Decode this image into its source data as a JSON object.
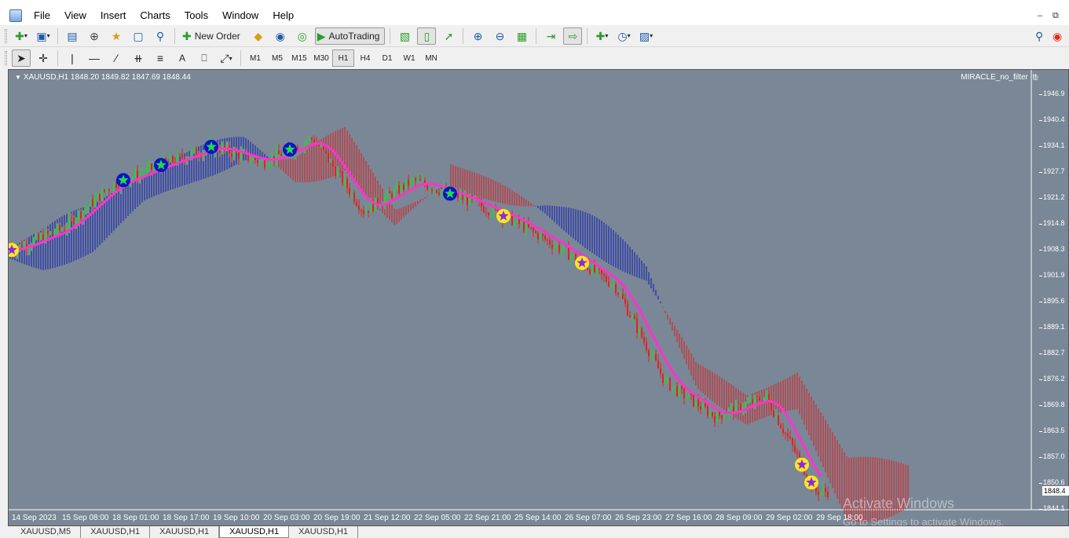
{
  "menubar": {
    "items": [
      "File",
      "View",
      "Insert",
      "Charts",
      "Tools",
      "Window",
      "Help"
    ]
  },
  "toolbar": {
    "new_order_label": "New Order",
    "autotrading_label": "AutoTrading"
  },
  "timeframes": [
    "M1",
    "M5",
    "M15",
    "M30",
    "H1",
    "H4",
    "D1",
    "W1",
    "MN"
  ],
  "active_timeframe": "H1",
  "chart": {
    "info": "XAUUSD,H1  1848.20 1849.82 1847.69 1848.44",
    "indicator_name": "MIRACLE_no_filter",
    "indicator_suffix": "!!!",
    "current_price": "1848.4",
    "price_ticks": [
      "1946.9",
      "1940.4",
      "1934.1",
      "1927.7",
      "1921.2",
      "1914.8",
      "1908.3",
      "1901.9",
      "1895.6",
      "1889.1",
      "1882.7",
      "1876.2",
      "1869.8",
      "1863.5",
      "1857.0",
      "1850.6",
      "1844.1"
    ],
    "time_ticks": [
      "14 Sep 2023",
      "15 Sep 08:00",
      "18 Sep 01:00",
      "18 Sep 17:00",
      "19 Sep 10:00",
      "20 Sep 03:00",
      "20 Sep 19:00",
      "21 Sep 12:00",
      "22 Sep 05:00",
      "22 Sep 21:00",
      "25 Sep 14:00",
      "26 Sep 07:00",
      "26 Sep 23:00",
      "27 Sep 16:00",
      "28 Sep 09:00",
      "29 Sep 02:00",
      "29 Sep 18:00"
    ],
    "colors": {
      "background": "#7a8796",
      "bull_candle": "#2ecc40",
      "bear_candle": "#e8201a",
      "ma_line": "#ff33cc",
      "cloud_bear": "#e01818",
      "cloud_bull": "#0a14b4",
      "signal_blue": "#0a14c8",
      "signal_yellow": "#ffe61e"
    }
  },
  "chart_data": {
    "type": "candlestick",
    "symbol": "XAUUSD",
    "timeframe": "H1",
    "ylim": [
      1844.1,
      1946.9
    ],
    "close_path": [
      [
        "14 Sep 2023",
        1908.3
      ],
      [
        "15 Sep 08:00",
        1913.5
      ],
      [
        "18 Sep 01:00",
        1924.5
      ],
      [
        "18 Sep 17:00",
        1929.5
      ],
      [
        "19 Sep 10:00",
        1934.0
      ],
      [
        "20 Sep 03:00",
        1930.0
      ],
      [
        "20 Sep 19:00",
        1936.0
      ],
      [
        "21 Sep 12:00",
        1918.0
      ],
      [
        "22 Sep 05:00",
        1925.5
      ],
      [
        "22 Sep 21:00",
        1921.0
      ],
      [
        "25 Sep 14:00",
        1915.5
      ],
      [
        "26 Sep 07:00",
        1908.0
      ],
      [
        "26 Sep 23:00",
        1899.5
      ],
      [
        "27 Sep 16:00",
        1875.5
      ],
      [
        "28 Sep 09:00",
        1867.0
      ],
      [
        "29 Sep 02:00",
        1872.0
      ],
      [
        "29 Sep 18:00",
        1848.44
      ]
    ]
  },
  "tabs": [
    "XAUUSD,M5",
    "XAUUSD,H1",
    "XAUUSD,H1",
    "XAUUSD,H1",
    "XAUUSD,H1"
  ],
  "active_tab_index": 3,
  "watermark": {
    "line1": "Activate Windows",
    "line2": "Go to Settings to activate Windows."
  }
}
